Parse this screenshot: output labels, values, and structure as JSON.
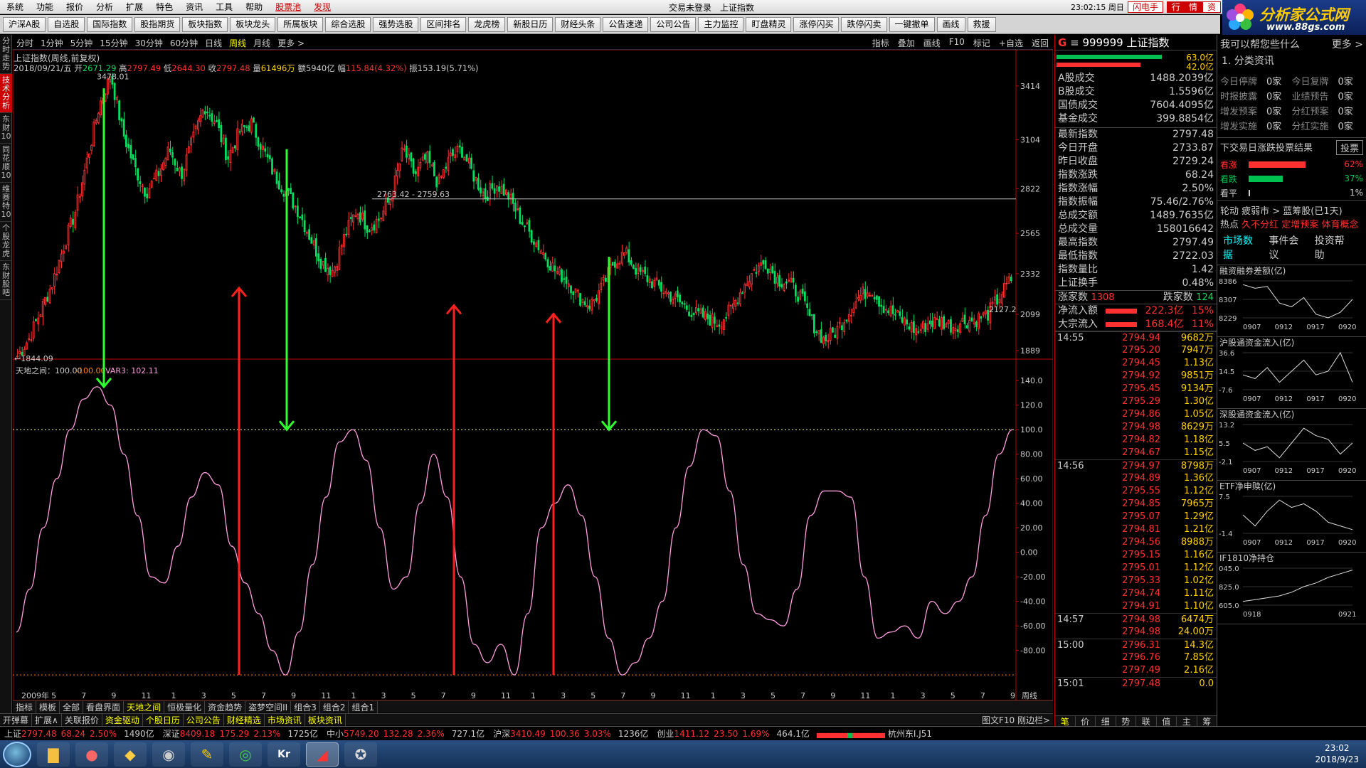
{
  "menu": {
    "items": [
      "系统",
      "功能",
      "报价",
      "分析",
      "扩展",
      "特色",
      "资讯",
      "工具",
      "帮助"
    ],
    "red1": "股票池",
    "red2": "发现",
    "window_title": "交易未登录　上证指数",
    "clock": "23:02:15 周日",
    "btn_flash": "闪电手",
    "btn_quote": "行　情",
    "btn_trade": "资"
  },
  "toolbar": {
    "items": [
      "沪深A股",
      "自选股",
      "国际指数",
      "股指期货",
      "板块指数",
      "板块龙头",
      "所属板块",
      "综合选股",
      "强势选股",
      "区间排名",
      "龙虎榜",
      "新股日历",
      "财经头条",
      "公告速递",
      "公司公告",
      "主力监控",
      "盯盘精灵",
      "涨停闪买",
      "跌停闪卖",
      "一键撤单",
      "画线",
      "救援"
    ]
  },
  "logo": {
    "title": "分析家公式网",
    "url": "www.88gs.com"
  },
  "lsidebar": [
    "分时走势",
    "技术分析",
    "东财10",
    "同花顺10",
    "维赛特10",
    "个股龙虎",
    "东财股吧"
  ],
  "period": {
    "items": [
      "分时",
      "1分钟",
      "5分钟",
      "15分钟",
      "30分钟",
      "60分钟",
      "日线",
      "周线",
      "月线",
      "更多 >"
    ],
    "active": 7,
    "tools": [
      "指标",
      "叠加",
      "画线",
      "F10",
      "标记",
      "+自选",
      "返回"
    ]
  },
  "chart": {
    "title": "上证指数(周线,前复权)",
    "info": {
      "date": "2018/09/21/五",
      "open_l": "开",
      "open": "2671.29",
      "high_l": "高",
      "high": "2797.49",
      "low_l": "低",
      "low": "2644.30",
      "close_l": "收",
      "close": "2797.48",
      "vol_l": "量",
      "vol": "61496万",
      "amt_l": "额",
      "amt": "5940亿",
      "chg_l": "幅",
      "chg": "115.84(4.32%)",
      "amp_l": "振",
      "amp": "153.19(5.71%)"
    },
    "max_label": "3478.01",
    "min_label": "←1844.09",
    "range_label": "2763.42 - 2759.63",
    "last_label": "2127.2",
    "yticks": [
      "3414",
      "3104",
      "2822",
      "2565",
      "2332",
      "2099",
      "1889"
    ],
    "ind_title": "天地之间：100.00",
    "ind_a": "-100.00",
    "ind_b": "VAR3: 102.11",
    "ind_yticks": [
      "140.0",
      "120.0",
      "100.0",
      "80.00",
      "60.00",
      "40.00",
      "20.00",
      "0.00",
      "-20.00",
      "-40.00",
      "-60.00",
      "-80.00"
    ],
    "xlabels": [
      "2009年",
      "5",
      "7",
      "9",
      "11",
      "1",
      "3",
      "5",
      "7",
      "9",
      "11",
      "1",
      "3",
      "5",
      "7",
      "9",
      "11",
      "1",
      "3",
      "5",
      "7",
      "9",
      "11",
      "1",
      "3",
      "5",
      "7",
      "9",
      "11",
      "1",
      "3",
      "5",
      "7",
      "9"
    ],
    "period_label": "周线"
  },
  "chart_data": {
    "type": "candlestick+oscillator",
    "price": {
      "ylim": [
        1844.09,
        3478.01
      ],
      "max": 3478.01,
      "min": 1844.09,
      "levels": [
        3414,
        3104,
        2822,
        2565,
        2332,
        2099,
        1889
      ],
      "close_path": [
        1860,
        1960,
        2120,
        2280,
        2500,
        2700,
        3000,
        3300,
        3478,
        3150,
        2950,
        2800,
        2900,
        3050,
        2900,
        3100,
        3300,
        3200,
        3000,
        3150,
        3200,
        3050,
        2900,
        2800,
        2700,
        2550,
        2400,
        2350,
        2550,
        2700,
        2600,
        2650,
        2780,
        3050,
        2900,
        3000,
        2850,
        3000,
        3050,
        2900,
        2780,
        2850,
        2780,
        2650,
        2550,
        2450,
        2350,
        2300,
        2200,
        2150,
        2250,
        2400,
        2450,
        2350,
        2300,
        2250,
        2200,
        2150,
        2100,
        2080,
        2050,
        2120,
        2250,
        2350,
        2400,
        2300,
        2280,
        2200,
        2050,
        1950,
        2000,
        2100,
        2200,
        2250,
        2150,
        2100,
        2050,
        2000,
        2050,
        2060,
        2030,
        2060,
        2070,
        2100,
        2200,
        2300
      ]
    },
    "indicator": {
      "ylim": [
        -100,
        140
      ],
      "osc": [
        -65,
        -30,
        20,
        60,
        100,
        125,
        135,
        120,
        80,
        30,
        -20,
        -25,
        5,
        45,
        65,
        55,
        5,
        -25,
        -50,
        -80,
        -100,
        -65,
        -10,
        45,
        90,
        100,
        75,
        20,
        -30,
        -20,
        40,
        80,
        45,
        -20,
        -75,
        -90,
        -75,
        -100,
        -50,
        20,
        40,
        55,
        30,
        -20,
        -70,
        -100,
        -90,
        -70,
        -40,
        20,
        70,
        100,
        95,
        50,
        -10,
        -50,
        -55,
        -60,
        -30,
        30,
        50,
        50,
        45,
        -20,
        -70,
        -65,
        -60,
        -70,
        -40,
        -50,
        -40,
        -20,
        30,
        80,
        100
      ]
    },
    "arrows": {
      "down": [
        [
          128,
          3400,
          135
        ],
        [
          385,
          3050,
          100
        ],
        [
          838,
          2430,
          100
        ]
      ],
      "up": [
        [
          318,
          -100,
          2250
        ],
        [
          620,
          -100,
          2150
        ],
        [
          760,
          -100,
          2100
        ]
      ]
    }
  },
  "quote": {
    "code": "999999 上证指数",
    "bar_red": "63.0亿",
    "bar_green": "42.0亿",
    "block1": [
      [
        "A股成交",
        "1488.2039亿"
      ],
      [
        "B股成交",
        "1.5596亿"
      ],
      [
        "国债成交",
        "7604.4095亿"
      ],
      [
        "基金成交",
        "399.8854亿"
      ]
    ],
    "block2": [
      [
        "最新指数",
        "2797.48",
        "red"
      ],
      [
        "今日开盘",
        "2733.87",
        "red"
      ],
      [
        "昨日收盘",
        "2729.24",
        "white"
      ],
      [
        "指数涨跌",
        "68.24",
        "red"
      ],
      [
        "指数涨幅",
        "2.50%",
        "red"
      ],
      [
        "指数振幅",
        "75.46/2.76%",
        "white"
      ],
      [
        "总成交额",
        "1489.7635亿",
        "yellow"
      ],
      [
        "总成交量",
        "158016642",
        "yellow"
      ],
      [
        "最高指数",
        "2797.49",
        "red"
      ],
      [
        "最低指数",
        "2722.03",
        "green"
      ],
      [
        "指数量比",
        "1.42",
        "red"
      ],
      [
        "上证换手",
        "0.48%",
        "white"
      ]
    ],
    "rise_l": "涨家数",
    "rise": "1308",
    "fall_l": "跌家数",
    "fall": "124",
    "flow1_l": "净流入额",
    "flow1": "222.3亿",
    "flow1_p": "15%",
    "flow2_l": "大宗流入",
    "flow2": "168.4亿",
    "flow2_p": "11%"
  },
  "ticks": [
    {
      "t": "14:55",
      "p": "2794.94",
      "v": "9682万"
    },
    {
      "t": "",
      "p": "2795.20",
      "v": "7947万"
    },
    {
      "t": "",
      "p": "2794.45",
      "v": "1.13亿"
    },
    {
      "t": "",
      "p": "2794.92",
      "v": "9851万"
    },
    {
      "t": "",
      "p": "2795.45",
      "v": "9134万"
    },
    {
      "t": "",
      "p": "2795.29",
      "v": "1.30亿"
    },
    {
      "t": "",
      "p": "2794.86",
      "v": "1.05亿"
    },
    {
      "t": "",
      "p": "2794.98",
      "v": "8629万"
    },
    {
      "t": "",
      "p": "2794.82",
      "v": "1.18亿"
    },
    {
      "t": "",
      "p": "2794.67",
      "v": "1.15亿"
    },
    {
      "t": "14:56",
      "p": "2794.97",
      "v": "8798万"
    },
    {
      "t": "",
      "p": "2794.89",
      "v": "1.36亿"
    },
    {
      "t": "",
      "p": "2795.55",
      "v": "1.12亿"
    },
    {
      "t": "",
      "p": "2794.85",
      "v": "7965万"
    },
    {
      "t": "",
      "p": "2795.07",
      "v": "1.29亿"
    },
    {
      "t": "",
      "p": "2794.81",
      "v": "1.21亿"
    },
    {
      "t": "",
      "p": "2794.56",
      "v": "8988万"
    },
    {
      "t": "",
      "p": "2795.15",
      "v": "1.16亿"
    },
    {
      "t": "",
      "p": "2795.01",
      "v": "1.12亿"
    },
    {
      "t": "",
      "p": "2795.33",
      "v": "1.02亿"
    },
    {
      "t": "",
      "p": "2794.74",
      "v": "1.11亿"
    },
    {
      "t": "",
      "p": "2794.91",
      "v": "1.10亿"
    },
    {
      "t": "14:57",
      "p": "2794.98",
      "v": "6474万"
    },
    {
      "t": "",
      "p": "2794.98",
      "v": "24.00万"
    },
    {
      "t": "15:00",
      "p": "2796.31",
      "v": "14.3亿"
    },
    {
      "t": "",
      "p": "2796.76",
      "v": "7.85亿"
    },
    {
      "t": "",
      "p": "2797.49",
      "v": "2.16亿"
    },
    {
      "t": "15:01",
      "p": "2797.48",
      "v": "0.0"
    }
  ],
  "ticktabs": [
    "笔",
    "价",
    "细",
    "势",
    "联",
    "值",
    "主",
    "筹"
  ],
  "far": {
    "ask": "我可以帮您些什么",
    "more": "更多 >",
    "cat": "1. 分类资讯",
    "stats": [
      [
        "今日停牌",
        "0家",
        "今日复牌",
        "0家"
      ],
      [
        "时报披露",
        "0家",
        "业绩预告",
        "0家"
      ],
      [
        "增发预案",
        "0家",
        "分红预案",
        "0家"
      ],
      [
        "增发实施",
        "0家",
        "分红实施",
        "0家"
      ]
    ],
    "vote_title": "下交易日涨跌投票结果",
    "vote_btn": "投票",
    "votes": [
      [
        "看涨",
        "62%"
      ],
      [
        "看跌",
        "37%"
      ],
      [
        "看平",
        "1%"
      ]
    ],
    "cat2": "轮动 疲弱市 > 蓝筹股(已1天)",
    "hot": "热点",
    "hot1": "久不分红",
    "hot2": "定增预案",
    "hot3": "体育概念",
    "tabs": [
      "市场数据",
      "事件会议",
      "投资帮助"
    ],
    "mini": [
      {
        "title": "融资融券差额(亿)",
        "y": [
          "8386",
          "8307",
          "8229"
        ],
        "x": [
          "0907",
          "0912",
          "0917",
          "0920"
        ],
        "pts": [
          0.9,
          0.8,
          0.85,
          0.4,
          0.3,
          0.55,
          0.1,
          0.0,
          0.15,
          0.5
        ]
      },
      {
        "title": "沪股通资金流入(亿)",
        "y": [
          "36.6",
          "14.5",
          "-7.6"
        ],
        "x": [
          "0907",
          "0912",
          "0917",
          "0920"
        ],
        "pts": [
          0.4,
          0.3,
          0.6,
          0.2,
          0.5,
          0.8,
          0.4,
          0.5,
          1.0,
          0.2
        ]
      },
      {
        "title": "深股通资金流入(亿)",
        "y": [
          "13.2",
          "5.5",
          "-2.1"
        ],
        "x": [
          "0907",
          "0912",
          "0917",
          "0920"
        ],
        "pts": [
          0.5,
          0.3,
          0.4,
          0.1,
          0.5,
          0.9,
          0.7,
          0.6,
          0.2,
          0.5
        ]
      },
      {
        "title": "ETF净申赎(亿)",
        "y": [
          "7.5",
          "-1.4"
        ],
        "x": [
          "0907",
          "0912",
          "0917",
          "0920"
        ],
        "pts": [
          0.5,
          0.2,
          0.6,
          0.9,
          0.7,
          0.8,
          0.6,
          0.3,
          0.2,
          0.1
        ]
      },
      {
        "title": "IF1810净持仓",
        "y": [
          "045.0",
          "825.0",
          "605.0"
        ],
        "x": [
          "0918",
          "0921"
        ],
        "pts": [
          0.1,
          0.15,
          0.2,
          0.25,
          0.35,
          0.5,
          0.6,
          0.75,
          0.85,
          0.95
        ]
      }
    ]
  },
  "bottabs": [
    "指标",
    "模板",
    "全部",
    "看盘界面",
    "天地之间",
    "恒极量化",
    "资金趋势",
    "盗梦空间II",
    "组合3",
    "组合2",
    "组合1"
  ],
  "bottabs2": [
    "开弹幕",
    "扩展∧",
    "关联报价",
    "资金驱动",
    "个股日历",
    "公司公告",
    "财经精选",
    "市场资讯",
    "板块资讯"
  ],
  "bot_right": [
    "图文F10",
    "刚边栏>"
  ],
  "indexbar": [
    {
      "n": "上证",
      "v": "2797.48",
      "c": "68.24",
      "p": "2.50%",
      "a": "1490亿"
    },
    {
      "n": "深证",
      "v": "8409.18",
      "c": "175.29",
      "p": "2.13%",
      "a": "1725亿"
    },
    {
      "n": "中小",
      "v": "5749.20",
      "c": "132.28",
      "p": "2.36%",
      "a": "727.1亿"
    },
    {
      "n": "沪深",
      "v": "3410.49",
      "c": "100.36",
      "p": "3.03%",
      "a": "1236亿"
    },
    {
      "n": "创业",
      "v": "1411.12",
      "c": "23.50",
      "p": "1.69%",
      "a": "464.1亿"
    }
  ],
  "indexbar_tail": "杭州东I.J51",
  "taskbar": {
    "time": "23:02",
    "date": "2018/9/23"
  }
}
